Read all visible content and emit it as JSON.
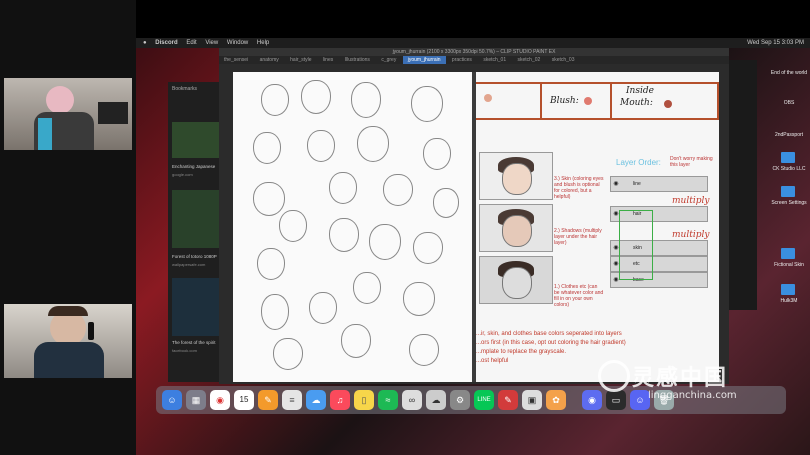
{
  "menubar": {
    "app": "Discord",
    "items": [
      "Edit",
      "View",
      "Window",
      "Help"
    ],
    "clock": "Wed Sep 15  3:03 PM"
  },
  "app": {
    "title": "jyoum_jhurrain (2100 x 3300px 350dpi 50.7%) – CLIP STUDIO PAINT EX",
    "tabs": [
      "the_sensei",
      "anatomy",
      "hair_style",
      "lines",
      "Illustrations",
      "c_grey",
      "jyoum_jhurrain",
      "practices",
      "sketch_01",
      "sketch_02",
      "sketch_03",
      "sketch_04",
      "proc_ref",
      "lineart_ref",
      "characters_ref"
    ],
    "active_tab": "jyoum_jhurrain"
  },
  "browser": {
    "items": [
      {
        "title": "Enchanting Japanese",
        "source": "google.com"
      },
      {
        "title": "Forest of totoro 1080P",
        "source": "wallpapersafe.com"
      },
      {
        "title": "The forest of the spirit",
        "source": "facebook.com"
      }
    ],
    "bookmarks": "Bookmarks"
  },
  "reference": {
    "strip_labels": {
      "blush": "Blush:",
      "inside": "Inside",
      "mouth": "Mouth:"
    },
    "layer_order_title": "Layer Order:",
    "note_top": "Don't worry making this layer",
    "steps": [
      {
        "text": "3.) Skin\n(coloring eyes and blush is optional for colored, but a helpful)"
      },
      {
        "text": "2.) Shadows\n(multiply layer under the hair layer)"
      },
      {
        "text": "1.) Clothes etc\n(can be whatever color and fill in on your own colors)"
      }
    ],
    "layers": [
      "line",
      "hair",
      "skin",
      "etc",
      "base"
    ],
    "multiply": "multiply",
    "notes": [
      "...ir, skin, and clothes base colors seperated into layers",
      "...ors first (in this case, opt out coloring the hair gradient)",
      "...mplate to replace the grayscale.",
      "...ost helpful"
    ]
  },
  "right_panel": {
    "items": [
      {
        "label": "End of the world"
      },
      {
        "label": "OBS"
      },
      {
        "label": "2ndPassport"
      },
      {
        "label": "CK Studio LLC"
      },
      {
        "label": "Screen Settings"
      },
      {
        "label": "Fictional Skin"
      },
      {
        "label": "Hulk3M"
      }
    ]
  },
  "dock": {
    "icons": [
      "finder-icon",
      "launchpad-icon",
      "chrome-icon",
      "calendar-icon",
      "pages-icon",
      "notes-icon",
      "chat-icon",
      "music-icon",
      "stickies-icon",
      "spotify-icon",
      "loop-icon",
      "cloud-icon",
      "settings-icon",
      "line-icon",
      "clip-icon",
      "preview-icon",
      "photos-icon",
      "photos2-icon",
      "screen-icon",
      "discord-icon",
      "trash-icon"
    ],
    "calendar_day": "15"
  },
  "watermark": {
    "text": "灵感中国",
    "url": "lingganchina.com"
  }
}
